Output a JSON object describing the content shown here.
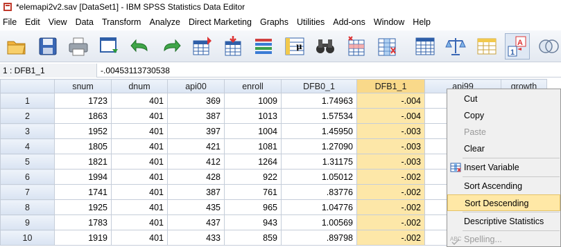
{
  "window": {
    "title": "*elemapi2v2.sav [DataSet1] - IBM SPSS Statistics Data Editor"
  },
  "menu": [
    "File",
    "Edit",
    "View",
    "Data",
    "Transform",
    "Analyze",
    "Direct Marketing",
    "Graphs",
    "Utilities",
    "Add-ons",
    "Window",
    "Help"
  ],
  "cellbar": {
    "ref": "1 : DFB1_1",
    "value": "-.00453113730538"
  },
  "columns": [
    "snum",
    "dnum",
    "api00",
    "enroll",
    "DFB0_1",
    "DFB1_1",
    "api99",
    "growth"
  ],
  "rows": [
    {
      "n": "1",
      "snum": "1723",
      "dnum": "401",
      "api00": "369",
      "enroll": "1009",
      "dfb0": "1.74963",
      "dfb1": "-.004"
    },
    {
      "n": "2",
      "snum": "1863",
      "dnum": "401",
      "api00": "387",
      "enroll": "1013",
      "dfb0": "1.57534",
      "dfb1": "-.004"
    },
    {
      "n": "3",
      "snum": "1952",
      "dnum": "401",
      "api00": "397",
      "enroll": "1004",
      "dfb0": "1.45950",
      "dfb1": "-.003"
    },
    {
      "n": "4",
      "snum": "1805",
      "dnum": "401",
      "api00": "421",
      "enroll": "1081",
      "dfb0": "1.27090",
      "dfb1": "-.003"
    },
    {
      "n": "5",
      "snum": "1821",
      "dnum": "401",
      "api00": "412",
      "enroll": "1264",
      "dfb0": "1.31175",
      "dfb1": "-.003"
    },
    {
      "n": "6",
      "snum": "1994",
      "dnum": "401",
      "api00": "428",
      "enroll": "922",
      "dfb0": "1.05012",
      "dfb1": "-.002"
    },
    {
      "n": "7",
      "snum": "1741",
      "dnum": "401",
      "api00": "387",
      "enroll": "761",
      "dfb0": ".83776",
      "dfb1": "-.002"
    },
    {
      "n": "8",
      "snum": "1925",
      "dnum": "401",
      "api00": "435",
      "enroll": "965",
      "dfb0": "1.04776",
      "dfb1": "-.002"
    },
    {
      "n": "9",
      "snum": "1783",
      "dnum": "401",
      "api00": "437",
      "enroll": "943",
      "dfb0": "1.00569",
      "dfb1": "-.002"
    },
    {
      "n": "10",
      "snum": "1919",
      "dnum": "401",
      "api00": "433",
      "enroll": "859",
      "dfb0": ".89798",
      "dfb1": "-.002"
    }
  ],
  "context_menu": {
    "items": [
      "Cut",
      "Copy",
      "Paste",
      "Clear",
      "Insert Variable",
      "Sort Ascending",
      "Sort Descending",
      "Descriptive Statistics",
      "Spelling..."
    ],
    "highlighted": "Sort Descending",
    "disabled": [
      "Paste",
      "Spelling..."
    ]
  },
  "colors": {
    "selected_column": "#fde7a8",
    "menu_highlight": "#ffe8a6"
  }
}
